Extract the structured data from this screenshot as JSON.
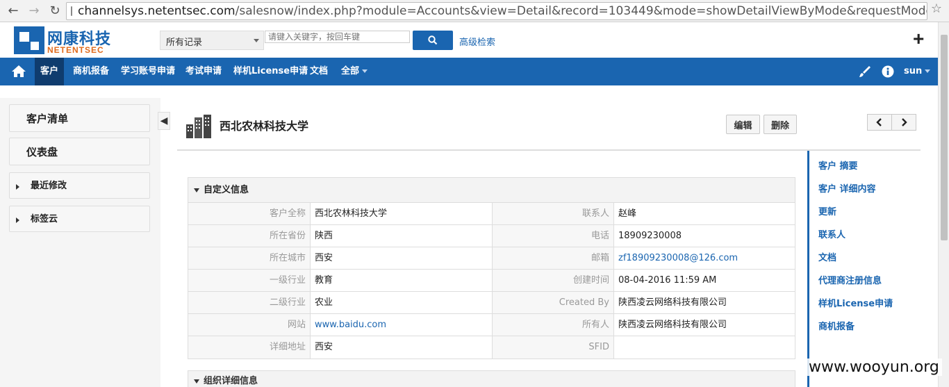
{
  "browser": {
    "url_host": "channelsys.netentsec.com",
    "url_path": "/salesnow/index.php?module=Accounts&view=Detail&record=103449&mode=showDetailViewByMode&requestMode=full"
  },
  "header": {
    "logo_cn": "网康科技",
    "logo_en": "NETENTSEC",
    "record_select": "所有记录",
    "search_placeholder": "请键入关键字，按回车键",
    "advanced_search": "高级检索",
    "plus": "+"
  },
  "nav": {
    "items": [
      "客户",
      "商机报备",
      "学习账号申请",
      "考试申请",
      "样机License申请",
      "文档",
      "全部"
    ],
    "user": "sun"
  },
  "sidebar": {
    "items": [
      "客户清单",
      "仪表盘",
      "最近修改",
      "标签云"
    ]
  },
  "record": {
    "title": "西北农林科技大学",
    "edit_label": "编辑",
    "delete_label": "删除",
    "prev": "‹",
    "next": "›"
  },
  "block": {
    "title": "自定义信息",
    "rows": [
      {
        "l1": "客户全称",
        "v1": "西北农林科技大学",
        "l2": "联系人",
        "v2": "赵峰"
      },
      {
        "l1": "所在省份",
        "v1": "陕西",
        "l2": "电话",
        "v2": "18909230008"
      },
      {
        "l1": "所在城市",
        "v1": "西安",
        "l2": "邮箱",
        "v2": "zf18909230008@126.com"
      },
      {
        "l1": "一级行业",
        "v1": "教育",
        "l2": "创建时间",
        "v2": "08-04-2016 11:59 AM"
      },
      {
        "l1": "二级行业",
        "v1": "农业",
        "l2": "Created By",
        "v2": " 陕西凌云网络科技有限公司"
      },
      {
        "l1": "网站",
        "v1": "www.baidu.com",
        "l2": "所有人",
        "v2": "陕西凌云网络科技有限公司"
      },
      {
        "l1": "详细地址",
        "v1": "西安",
        "l2": "SFID",
        "v2": ""
      }
    ]
  },
  "block2": {
    "title": "组织详细信息"
  },
  "related": {
    "items": [
      "客户 摘要",
      "客户 详细内容",
      "更新",
      "联系人",
      "文档",
      "代理商注册信息",
      "样机License申请",
      "商机报备"
    ]
  },
  "watermark": "www.wooyun.org",
  "colors": {
    "brand": "#1a65b0",
    "brand_dark": "#0f3c6e",
    "logo_orange": "#e06a1b"
  }
}
